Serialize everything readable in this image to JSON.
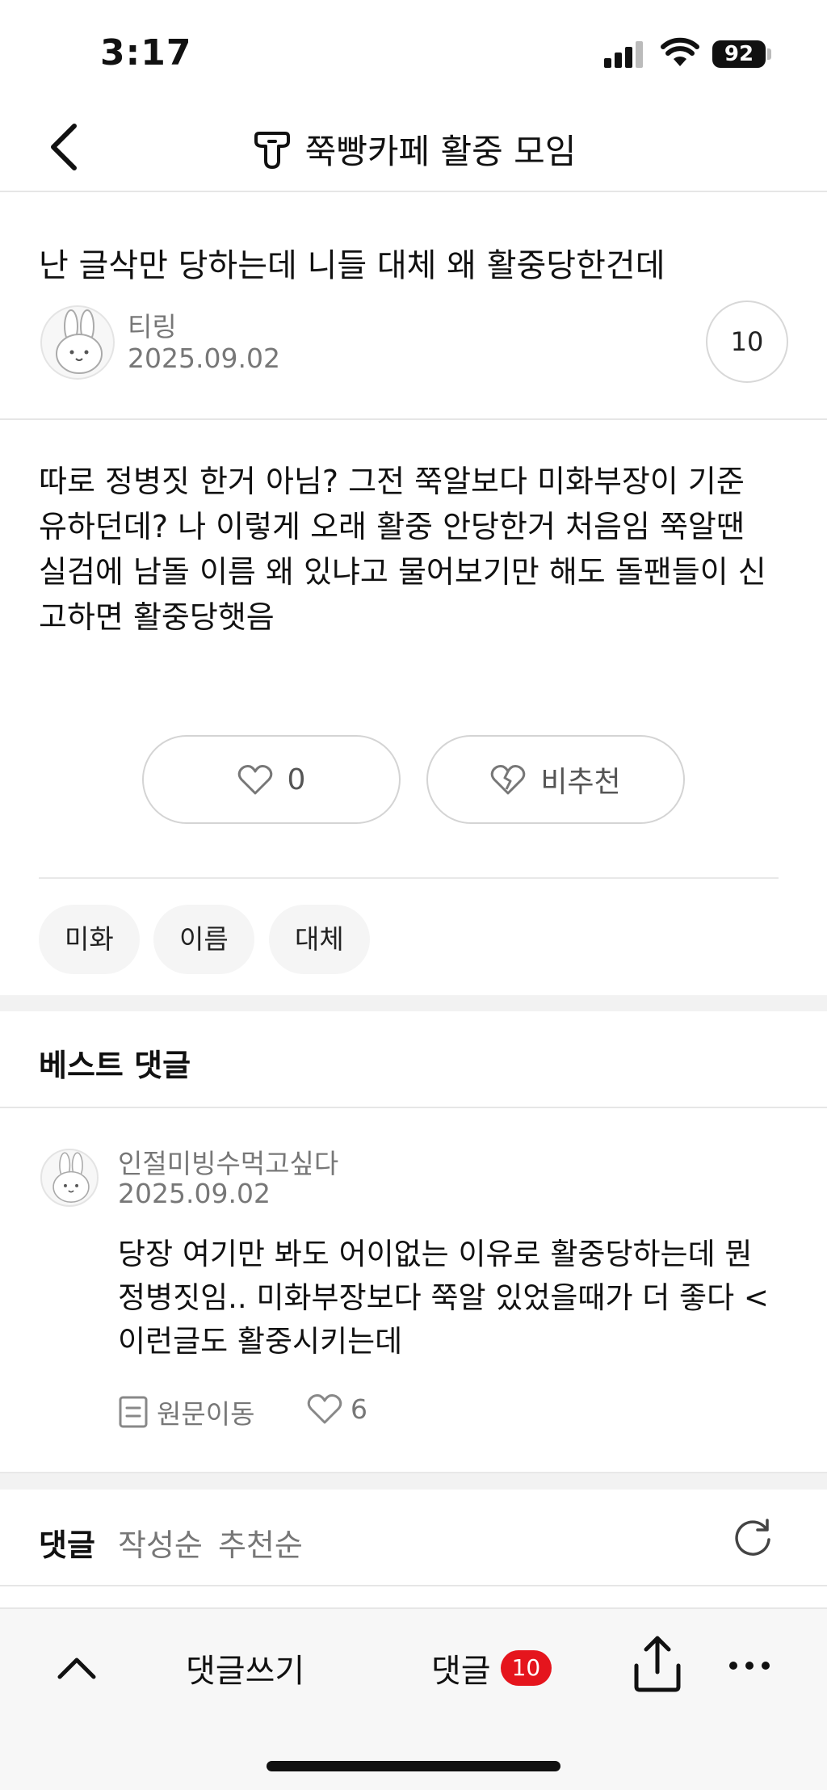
{
  "status_bar": {
    "time": "3:17",
    "battery": "92"
  },
  "header": {
    "title": "쭉빵카페 활중 모임"
  },
  "post": {
    "title": "난 글삭만 당하는데 니들 대체 왜 활중당한건데",
    "author": "티링",
    "date": "2025.09.02",
    "comment_count": "10",
    "body_lines": [
      "따로 정병짓 한거 아님? 그전 쭉알보다 미화부장이 기준",
      "유하던데? 나 이렇게 오래 활중 안당한거 처음임 쭉알땐",
      "실검에 남돌 이름 왜 있냐고 물어보기만 해도 돌팬들이 신",
      "고하면 활중당햇음"
    ],
    "like_count": "0",
    "dislike_label": "비추천",
    "tags": [
      "미화",
      "이름",
      "대체"
    ]
  },
  "best_comments": {
    "title": "베스트 댓글",
    "items": [
      {
        "author": "인절미빙수먹고싶다",
        "date": "2025.09.02",
        "body_lines": [
          "당장 여기만 봐도 어이없는 이유로 활중당하는데 뭔",
          "정병짓임.. 미화부장보다 쭉알 있었을때가 더 좋다 <",
          "이런글도 활중시키는데"
        ],
        "source_label": "원문이동",
        "likes": "6"
      }
    ]
  },
  "comments_section": {
    "label": "댓글",
    "sort_options": [
      "작성순",
      "추천순"
    ]
  },
  "bottom_bar": {
    "write_label": "댓글쓰기",
    "comments_label": "댓글",
    "comments_badge": "10"
  },
  "colors": {
    "badge_red": "#e5151d",
    "muted_text": "#777777"
  }
}
